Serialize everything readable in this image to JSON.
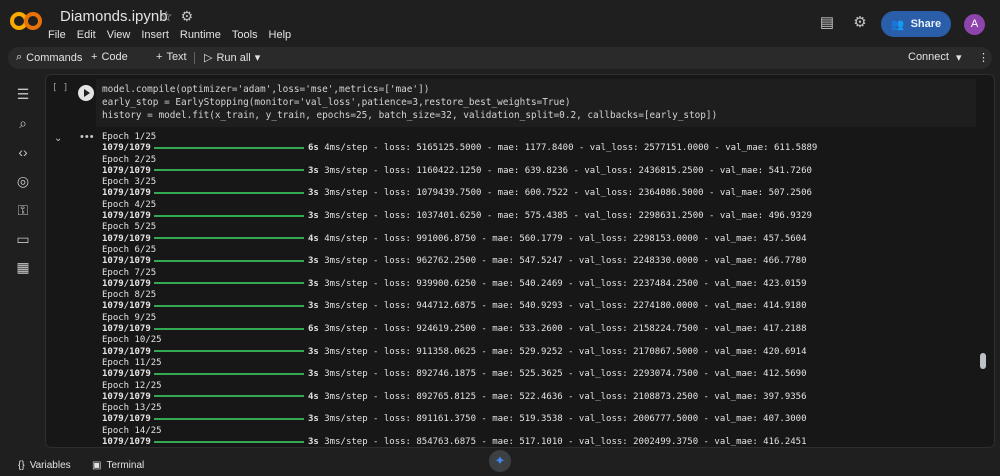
{
  "header": {
    "title": "Diamonds.ipynb",
    "menu": [
      "File",
      "Edit",
      "View",
      "Insert",
      "Runtime",
      "Tools",
      "Help"
    ],
    "share_label": "Share",
    "avatar_letter": "A"
  },
  "toolbar": {
    "commands_label": "Commands",
    "code_label": "Code",
    "text_label": "Text",
    "run_all_label": "Run all",
    "connect_label": "Connect"
  },
  "cell": {
    "bracket": "[ ]",
    "code_lines": [
      "model.compile(optimizer='adam',loss='mse',metrics=['mae'])",
      "early_stop = EarlyStopping(monitor='val_loss',patience=3,restore_best_weights=True)",
      "history = model.fit(x_train, y_train, epochs=25, batch_size=32, validation_split=0.2, callbacks=[early_stop])"
    ]
  },
  "output": {
    "epochs": [
      {
        "epoch": "Epoch 1/25",
        "step": "1079/1079",
        "time": "6s",
        "rest": "4ms/step - loss: 5165125.5000 - mae: 1177.8400 - val_loss: 2577151.0000 - val_mae: 611.5889"
      },
      {
        "epoch": "Epoch 2/25",
        "step": "1079/1079",
        "time": "3s",
        "rest": "3ms/step - loss: 1160422.1250 - mae: 639.8236 - val_loss: 2436815.2500 - val_mae: 541.7260"
      },
      {
        "epoch": "Epoch 3/25",
        "step": "1079/1079",
        "time": "3s",
        "rest": "3ms/step - loss: 1079439.7500 - mae: 600.7522 - val_loss: 2364086.5000 - val_mae: 507.2506"
      },
      {
        "epoch": "Epoch 4/25",
        "step": "1079/1079",
        "time": "3s",
        "rest": "3ms/step - loss: 1037401.6250 - mae: 575.4385 - val_loss: 2298631.2500 - val_mae: 496.9329"
      },
      {
        "epoch": "Epoch 5/25",
        "step": "1079/1079",
        "time": "4s",
        "rest": "4ms/step - loss: 991006.8750 - mae: 560.1779 - val_loss: 2298153.0000 - val_mae: 457.5604"
      },
      {
        "epoch": "Epoch 6/25",
        "step": "1079/1079",
        "time": "3s",
        "rest": "3ms/step - loss: 962762.2500 - mae: 547.5247 - val_loss: 2248330.0000 - val_mae: 466.7780"
      },
      {
        "epoch": "Epoch 7/25",
        "step": "1079/1079",
        "time": "3s",
        "rest": "3ms/step - loss: 939900.6250 - mae: 540.2469 - val_loss: 2237484.2500 - val_mae: 423.0159"
      },
      {
        "epoch": "Epoch 8/25",
        "step": "1079/1079",
        "time": "3s",
        "rest": "3ms/step - loss: 944712.6875 - mae: 540.9293 - val_loss: 2274180.0000 - val_mae: 414.9180"
      },
      {
        "epoch": "Epoch 9/25",
        "step": "1079/1079",
        "time": "6s",
        "rest": "3ms/step - loss: 924619.2500 - mae: 533.2600 - val_loss: 2158224.7500 - val_mae: 417.2188"
      },
      {
        "epoch": "Epoch 10/25",
        "step": "1079/1079",
        "time": "3s",
        "rest": "3ms/step - loss: 911358.0625 - mae: 529.9252 - val_loss: 2170867.5000 - val_mae: 420.6914"
      },
      {
        "epoch": "Epoch 11/25",
        "step": "1079/1079",
        "time": "3s",
        "rest": "3ms/step - loss: 892746.1875 - mae: 525.3625 - val_loss: 2293074.7500 - val_mae: 412.5690"
      },
      {
        "epoch": "Epoch 12/25",
        "step": "1079/1079",
        "time": "4s",
        "rest": "3ms/step - loss: 892765.8125 - mae: 522.4636 - val_loss: 2108873.2500 - val_mae: 397.9356"
      },
      {
        "epoch": "Epoch 13/25",
        "step": "1079/1079",
        "time": "3s",
        "rest": "3ms/step - loss: 891161.3750 - mae: 519.3538 - val_loss: 2006777.5000 - val_mae: 407.3000"
      },
      {
        "epoch": "Epoch 14/25",
        "step": "1079/1079",
        "time": "3s",
        "rest": "3ms/step - loss: 854763.6875 - mae: 517.1010 - val_loss: 2002499.3750 - val_mae: 416.2451"
      }
    ]
  },
  "bottom": {
    "variables_label": "Variables",
    "terminal_label": "Terminal"
  },
  "colors": {
    "progress": "#34a853",
    "accent": "#4285f4"
  }
}
